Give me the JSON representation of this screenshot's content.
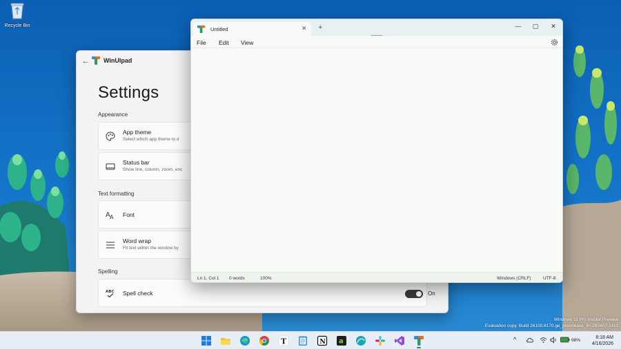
{
  "desktop": {
    "recycle_bin_label": "Recycle Bin",
    "watermark_line1": "Windows 11 Pro Insider Preview",
    "watermark_line2": "Evaluation copy. Build 26100.8170.ge_prerelease_im.260407-1411"
  },
  "settings": {
    "app_name": "WinUIpad",
    "heading": "Settings",
    "sections": {
      "appearance": "Appearance",
      "text_formatting": "Text formatting",
      "spelling": "Spelling"
    },
    "cards": {
      "app_theme": {
        "title": "App theme",
        "desc": "Select which app theme to d"
      },
      "status_bar": {
        "title": "Status bar",
        "desc": "Show line, column, zoom, enc"
      },
      "font": {
        "title": "Font"
      },
      "word_wrap": {
        "title": "Word wrap",
        "desc": "Fit text within the window by"
      },
      "spell_check": {
        "title": "Spell check",
        "toggle_label": "On",
        "enabled": true
      }
    }
  },
  "notepad": {
    "tab_title": "Untitled",
    "tab_close": "✕",
    "new_tab": "+",
    "window_controls": {
      "minimize": "—",
      "maximize": "▢",
      "close": "✕"
    },
    "menu": {
      "file": "File",
      "edit": "Edit",
      "view": "View"
    },
    "status": {
      "position": "Ln 1, Col 1",
      "words": "0 words",
      "zoom": "100%",
      "line_ending": "Windows (CRLF)",
      "encoding": "UTF-8"
    }
  },
  "taskbar": {
    "battery": "98%",
    "time": "8:18 AM",
    "date": "4/16/2026",
    "tray_chevron": "^",
    "icons": [
      "start-icon",
      "file-explorer-icon",
      "edge-icon",
      "chrome-icon",
      "typora-icon",
      "notepad-icon",
      "notion-icon",
      "amazon-icon",
      "browser-icon",
      "slack-icon",
      "visual-studio-icon",
      "winuipad-icon"
    ]
  },
  "colors": {
    "accent_green": "#2e9a5e",
    "accent_orange": "#e36b2d",
    "desktop_blue": "#0e63b8",
    "toggle_on": "#3a3a3a"
  }
}
